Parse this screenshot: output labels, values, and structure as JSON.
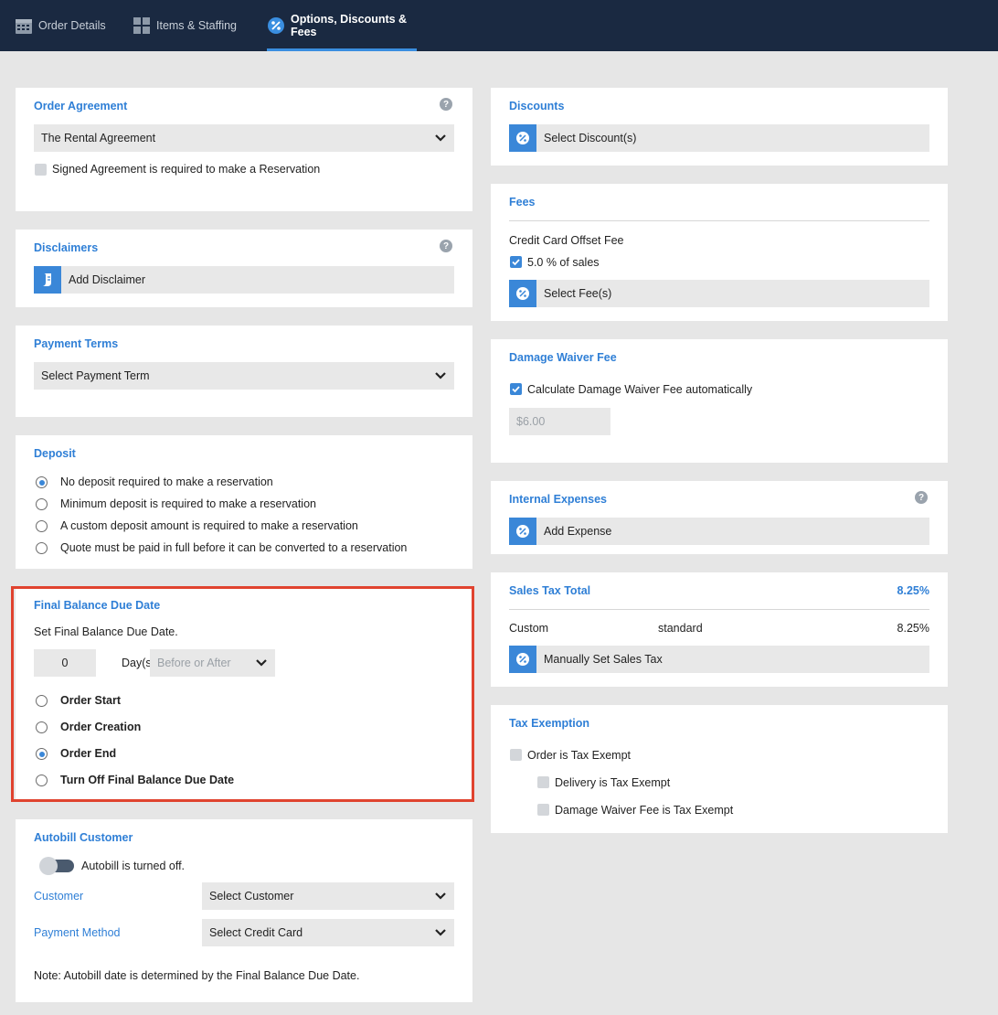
{
  "tabs": [
    {
      "label": "Order Details",
      "icon": "calendar-icon"
    },
    {
      "label": "Items & Staffing",
      "icon": "grid-icon"
    },
    {
      "label": "Options, Discounts & Fees",
      "icon": "percent-badge-icon"
    }
  ],
  "accent_color": "#2f7fd6",
  "highlight_color": "#e0432f",
  "order_agreement": {
    "title": "Order Agreement",
    "selected": "The Rental Agreement",
    "signed_label": "Signed Agreement is required to make a Reservation"
  },
  "disclaimers": {
    "title": "Disclaimers",
    "add_label": "Add Disclaimer"
  },
  "payment_terms": {
    "title": "Payment Terms",
    "placeholder": "Select Payment Term"
  },
  "deposit": {
    "title": "Deposit",
    "options": [
      "No deposit required to make a reservation",
      "Minimum deposit is required to make a reservation",
      "A custom deposit amount is required to make a reservation",
      "Quote must be paid in full before it can be converted to a reservation"
    ],
    "selected_index": 0
  },
  "final_balance": {
    "title": "Final Balance Due Date",
    "subtitle": "Set Final Balance Due Date.",
    "days_value": "0",
    "days_label": "Day(s)",
    "before_after_placeholder": "Before or After",
    "options": [
      "Order Start",
      "Order Creation",
      "Order End",
      "Turn Off Final Balance Due Date"
    ],
    "selected_index": 2
  },
  "autobill": {
    "title": "Autobill Customer",
    "toggle_label": "Autobill is turned off.",
    "customer_label": "Customer",
    "customer_placeholder": "Select Customer",
    "payment_method_label": "Payment Method",
    "payment_method_placeholder": "Select Credit Card",
    "note": "Note: Autobill date is determined by the Final Balance Due Date."
  },
  "discounts": {
    "title": "Discounts",
    "select_label": "Select Discount(s)"
  },
  "fees": {
    "title": "Fees",
    "fee_name": "Credit Card Offset Fee",
    "fee_value": "5.0 % of sales",
    "select_label": "Select Fee(s)"
  },
  "damage_waiver": {
    "title": "Damage Waiver Fee",
    "auto_label": "Calculate Damage Waiver Fee automatically",
    "amount": "$6.00"
  },
  "internal_expenses": {
    "title": "Internal Expenses",
    "add_label": "Add Expense"
  },
  "sales_tax": {
    "title": "Sales Tax Total",
    "total": "8.25%",
    "row_name": "Custom",
    "row_type": "standard",
    "row_rate": "8.25%",
    "manual_label": "Manually Set Sales Tax"
  },
  "tax_exemption": {
    "title": "Tax Exemption",
    "order_exempt": "Order is Tax Exempt",
    "delivery_exempt": "Delivery is Tax Exempt",
    "damage_waiver_exempt": "Damage Waiver Fee is Tax Exempt"
  }
}
